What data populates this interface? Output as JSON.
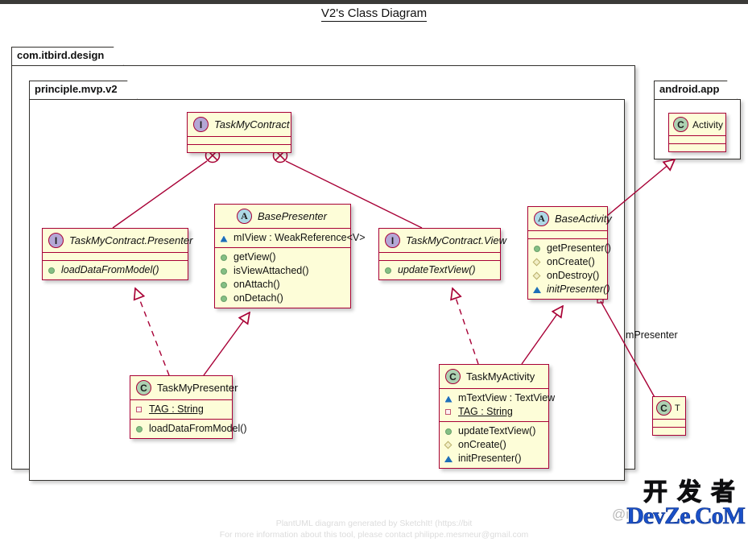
{
  "title": "V2's Class Diagram",
  "packages": [
    {
      "name": "com.itbird.design"
    },
    {
      "name": "principle.mvp.v2"
    },
    {
      "name": "android.app"
    }
  ],
  "classes": {
    "task_my_contract": {
      "name": "TaskMyContract",
      "stereotype": "I",
      "kind": "interface",
      "fields": [],
      "methods": []
    },
    "task_my_contract_presenter": {
      "name": "TaskMyContract.Presenter",
      "stereotype": "I",
      "kind": "interface",
      "fields": [],
      "methods": [
        {
          "visibility": "public",
          "text": "loadDataFromModel()"
        }
      ]
    },
    "base_presenter": {
      "name": "BasePresenter",
      "stereotype": "A",
      "kind": "abstract",
      "fields": [
        {
          "visibility": "protected",
          "text": "mIView : WeakReference<V>"
        }
      ],
      "methods": [
        {
          "visibility": "public",
          "text": "getView()"
        },
        {
          "visibility": "public",
          "text": "isViewAttached()"
        },
        {
          "visibility": "public",
          "text": "onAttach()"
        },
        {
          "visibility": "public",
          "text": "onDetach()"
        }
      ]
    },
    "task_my_contract_view": {
      "name": "TaskMyContract.View",
      "stereotype": "I",
      "kind": "interface",
      "fields": [],
      "methods": [
        {
          "visibility": "public",
          "text": "updateTextView()"
        }
      ]
    },
    "base_activity": {
      "name": "BaseActivity",
      "stereotype": "A",
      "kind": "abstract",
      "fields": [],
      "methods": [
        {
          "visibility": "public",
          "text": "getPresenter()"
        },
        {
          "visibility": "package",
          "text": "onCreate()"
        },
        {
          "visibility": "package",
          "text": "onDestroy()"
        },
        {
          "visibility": "protected",
          "text": "initPresenter()"
        }
      ]
    },
    "task_my_presenter": {
      "name": "TaskMyPresenter",
      "stereotype": "C",
      "kind": "class",
      "fields": [
        {
          "visibility": "private",
          "text": "TAG : String",
          "static": true
        }
      ],
      "methods": [
        {
          "visibility": "public",
          "text": "loadDataFromModel()"
        }
      ]
    },
    "task_my_activity": {
      "name": "TaskMyActivity",
      "stereotype": "C",
      "kind": "class",
      "fields": [
        {
          "visibility": "protected",
          "text": "mTextView : TextView"
        },
        {
          "visibility": "private",
          "text": "TAG : String",
          "static": true
        }
      ],
      "methods": [
        {
          "visibility": "public",
          "text": "updateTextView()"
        },
        {
          "visibility": "package",
          "text": "onCreate()"
        },
        {
          "visibility": "protected",
          "text": "initPresenter()"
        }
      ]
    },
    "activity": {
      "name": "Activity",
      "stereotype": "C",
      "kind": "class",
      "fields": [],
      "methods": []
    },
    "type_param_t": {
      "name": "T",
      "stereotype": "C",
      "kind": "class",
      "fields": [],
      "methods": []
    }
  },
  "relations": [
    {
      "from": "TaskMyContract",
      "to": "TaskMyContract.Presenter",
      "type": "nesting",
      "label": ""
    },
    {
      "from": "TaskMyContract",
      "to": "TaskMyContract.View",
      "type": "nesting",
      "label": ""
    },
    {
      "from": "TaskMyPresenter",
      "to": "TaskMyContract.Presenter",
      "type": "implements",
      "label": ""
    },
    {
      "from": "TaskMyPresenter",
      "to": "BasePresenter",
      "type": "extends",
      "label": ""
    },
    {
      "from": "TaskMyActivity",
      "to": "TaskMyContract.View",
      "type": "implements",
      "label": ""
    },
    {
      "from": "TaskMyActivity",
      "to": "BaseActivity",
      "type": "extends",
      "label": ""
    },
    {
      "from": "BaseActivity",
      "to": "Activity",
      "type": "extends",
      "label": ""
    },
    {
      "from": "BaseActivity",
      "to": "T",
      "type": "association",
      "label": "mPresenter"
    }
  ],
  "edge_labels": {
    "m_presenter": "mPresenter"
  },
  "footer": {
    "line1": "PlantUML diagram generated by SketchIt! (https://bit",
    "line2": "For more information about this tool, please contact philippe.mesmeur@gmail.com"
  },
  "watermark": {
    "cn": "开发者",
    "en": "DevZe.CoM",
    "at": "@i"
  },
  "colors": {
    "class_fill": "#fdfdd8",
    "class_border": "#a80036",
    "link": "#a80036",
    "package_border": "#33312e",
    "interface_icon": "#b4a7d6",
    "abstract_icon": "#add8e6",
    "class_icon": "#add1b2",
    "public_marker": "#84bf84",
    "protected_marker": "#1d6fb8",
    "private_marker": "#c2566f",
    "watermark_blue": "#1a50c8"
  }
}
